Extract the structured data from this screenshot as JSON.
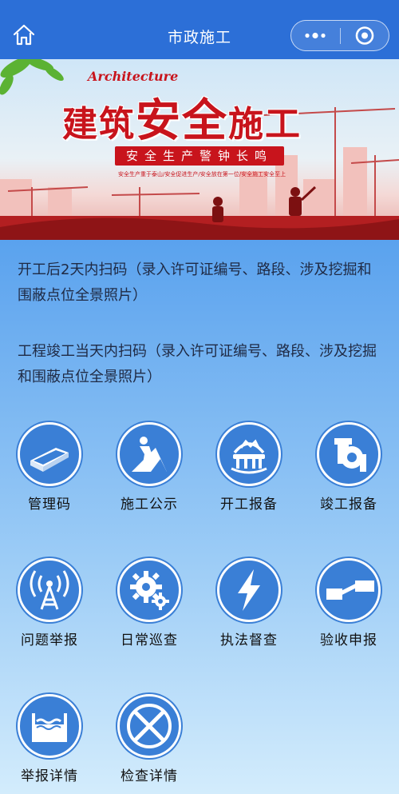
{
  "header": {
    "title": "市政施工",
    "home_icon": "home-icon",
    "more_icon": "more-dots-icon",
    "close_icon": "target-close-icon",
    "bar_color": "#2c6fd7"
  },
  "banner": {
    "subtitle": "Architecture",
    "title_part1": "建筑",
    "title_part2": "安全",
    "title_part3": "施工",
    "slogan": "安全生产警钟长鸣",
    "small_text": "安全生产重于泰山/安全促进生产/安全放在第一位/安全施工安全至上",
    "accent_color": "#c8141c"
  },
  "notices": [
    "开工后2天内扫码（录入许可证编号、路段、涉及挖掘和围蔽点位全景照片）",
    "工程竣工当天内扫码（录入许可证编号、路段、涉及挖掘和围蔽点位全景照片）"
  ],
  "menu": [
    {
      "label": "管理码",
      "icon": "steel-beam-icon"
    },
    {
      "label": "施工公示",
      "icon": "construction-worker-icon"
    },
    {
      "label": "开工报备",
      "icon": "hard-hat-icon"
    },
    {
      "label": "竣工报备",
      "icon": "pipe-fitting-icon"
    },
    {
      "label": "问题举报",
      "icon": "signal-tower-icon"
    },
    {
      "label": "日常巡查",
      "icon": "gears-icon"
    },
    {
      "label": "执法督查",
      "icon": "lightning-icon"
    },
    {
      "label": "验收申报",
      "icon": "switch-icon"
    },
    {
      "label": "举报详情",
      "icon": "water-tank-icon"
    },
    {
      "label": "检查详情",
      "icon": "x-circle-icon"
    }
  ],
  "colors": {
    "icon_fill": "#3a7fd6",
    "text": "#111111"
  }
}
